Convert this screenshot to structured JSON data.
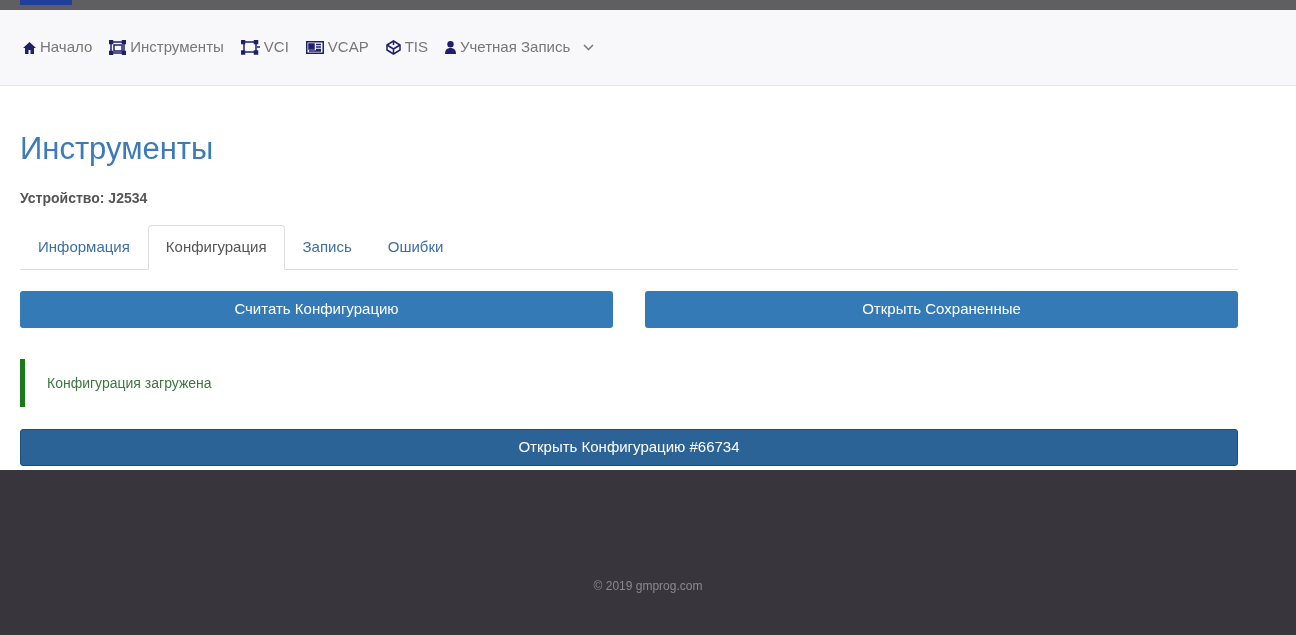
{
  "nav": {
    "items": [
      {
        "kind": "home",
        "label": "Начало"
      },
      {
        "kind": "tools",
        "label": "Инструменты"
      },
      {
        "kind": "vci",
        "label": "VCI"
      },
      {
        "kind": "vcap",
        "label": "VCAP"
      },
      {
        "kind": "tis",
        "label": "TIS"
      },
      {
        "kind": "account",
        "label": "Учетная Запись",
        "dropdown": true
      }
    ]
  },
  "page": {
    "title": "Инструменты",
    "device": "Устройство: J2534",
    "tabs": [
      {
        "label": "Информация",
        "selected": false
      },
      {
        "label": "Конфигурация",
        "selected": true
      },
      {
        "label": "Запись",
        "selected": false
      },
      {
        "label": "Ошибки",
        "selected": false
      }
    ],
    "actions": [
      "Считать Конфигурацию",
      "Открыть Сохраненные"
    ],
    "alert": {
      "kind": "success",
      "text": "Конфигурация загружена"
    },
    "open_button": "Открыть Конфигурацию #66734"
  },
  "footer": {
    "text": "© 2019 gmprog.com"
  }
}
